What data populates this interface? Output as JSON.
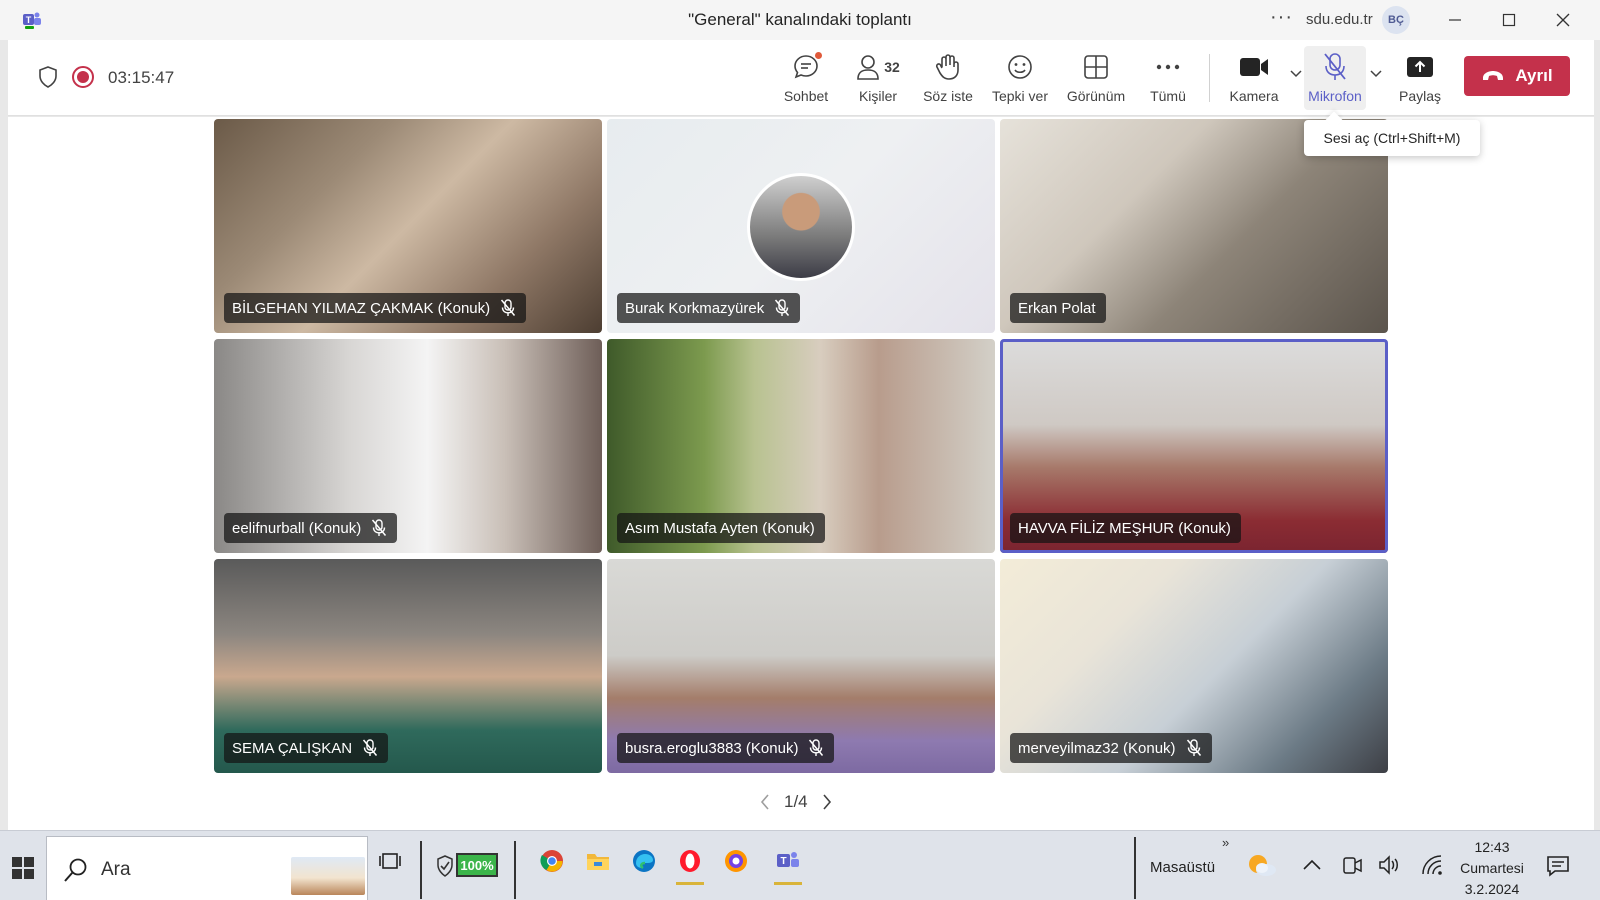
{
  "window": {
    "title": "\"General\" kanalındaki toplantı",
    "org": "sdu.edu.tr",
    "avatar_initials": "BÇ",
    "more": "···"
  },
  "meeting": {
    "timer": "03:15:47",
    "people_count": "32",
    "toolbar": [
      {
        "id": "chat",
        "label": "Sohbet",
        "icon": "chat-icon"
      },
      {
        "id": "people",
        "label": "Kişiler",
        "icon": "people-icon"
      },
      {
        "id": "raise",
        "label": "Söz iste",
        "icon": "raise-hand-icon"
      },
      {
        "id": "react",
        "label": "Tepki ver",
        "icon": "smiley-icon"
      },
      {
        "id": "view",
        "label": "Görünüm",
        "icon": "grid-view-icon"
      },
      {
        "id": "more",
        "label": "Tümü",
        "icon": "more-icon"
      },
      {
        "id": "camera",
        "label": "Kamera",
        "icon": "camera-icon"
      },
      {
        "id": "mic",
        "label": "Mikrofon",
        "icon": "mic-off-icon"
      },
      {
        "id": "share",
        "label": "Paylaş",
        "icon": "share-icon"
      }
    ],
    "leave_label": "Ayrıl",
    "tooltip": "Sesi aç (Ctrl+Shift+M)"
  },
  "colors": {
    "accent": "#5b5fc7",
    "leave": "#c4314b",
    "recording": "#c4314b"
  },
  "participants": [
    {
      "name": "BİLGEHAN YILMAZ ÇAKMAK (Konuk)",
      "muted": true,
      "bg": "linear-gradient(135deg,#6b5a48 0%,#9c8a76 30%,#cdb9a3 50%,#8f7866 75%,#4d3e32 100%)"
    },
    {
      "name": "Burak Korkmazyürek",
      "muted": true,
      "avatar": true,
      "bg": "linear-gradient(135deg,#e7ecef 0%,#eef0f2 50%,#e4e2ea 100%)"
    },
    {
      "name": "Erkan Polat",
      "muted": false,
      "bg": "linear-gradient(135deg,#e6e2da 0%,#cfc7bc 35%,#8d8478 60%,#5b544c 100%)"
    },
    {
      "name": "eelifnurball (Konuk)",
      "muted": true,
      "bg": "linear-gradient(90deg,#8a8886 0%,#d8d6d4 35%,#f4f4f4 55%,#c9bfb7 75%,#6e5e58 100%)"
    },
    {
      "name": "Asım Mustafa Ayten (Konuk)",
      "muted": false,
      "bg": "linear-gradient(90deg,#3f5a2a 0%,#7c9a4e 25%,#b8c290 38%,#d8cdbf 55%,#b89c8c 70%,#d3d0c8 100%)"
    },
    {
      "name": "HAVVA FİLİZ MEŞHUR (Konuk)",
      "muted": false,
      "speaking": true,
      "bg": "linear-gradient(180deg,#dcdcdc 0%,#cfc9c4 40%,#a7796a 60%,#8b2c33 85%,#7a2430 100%)"
    },
    {
      "name": "SEMA ÇALIŞKAN",
      "muted": true,
      "bg": "linear-gradient(180deg,#5a5a5a 0%,#8c8680 35%,#c9a88e 55%,#2f6a5c 80%,#24584c 100%)"
    },
    {
      "name": "busra.eroglu3883 (Konuk)",
      "muted": true,
      "bg": "linear-gradient(180deg,#d9d9d6 0%,#cdccc8 45%,#a47d6a 65%,#8e7ab0 85%,#7d6aa2 100%)"
    },
    {
      "name": "merveyilmaz32 (Konuk)",
      "muted": true,
      "bg": "linear-gradient(135deg,#f3ecd8 0%,#e9e4d8 30%,#c7cfd6 55%,#6c7b86 80%,#3d3f45 100%)"
    }
  ],
  "pager": {
    "label": "1/4"
  },
  "taskbar": {
    "search_placeholder": "Ara",
    "battery": "100%",
    "desktop": "Masaüstü",
    "chevrons": "»",
    "time": "12:43",
    "day": "Cumartesi",
    "date": "3.2.2024"
  }
}
